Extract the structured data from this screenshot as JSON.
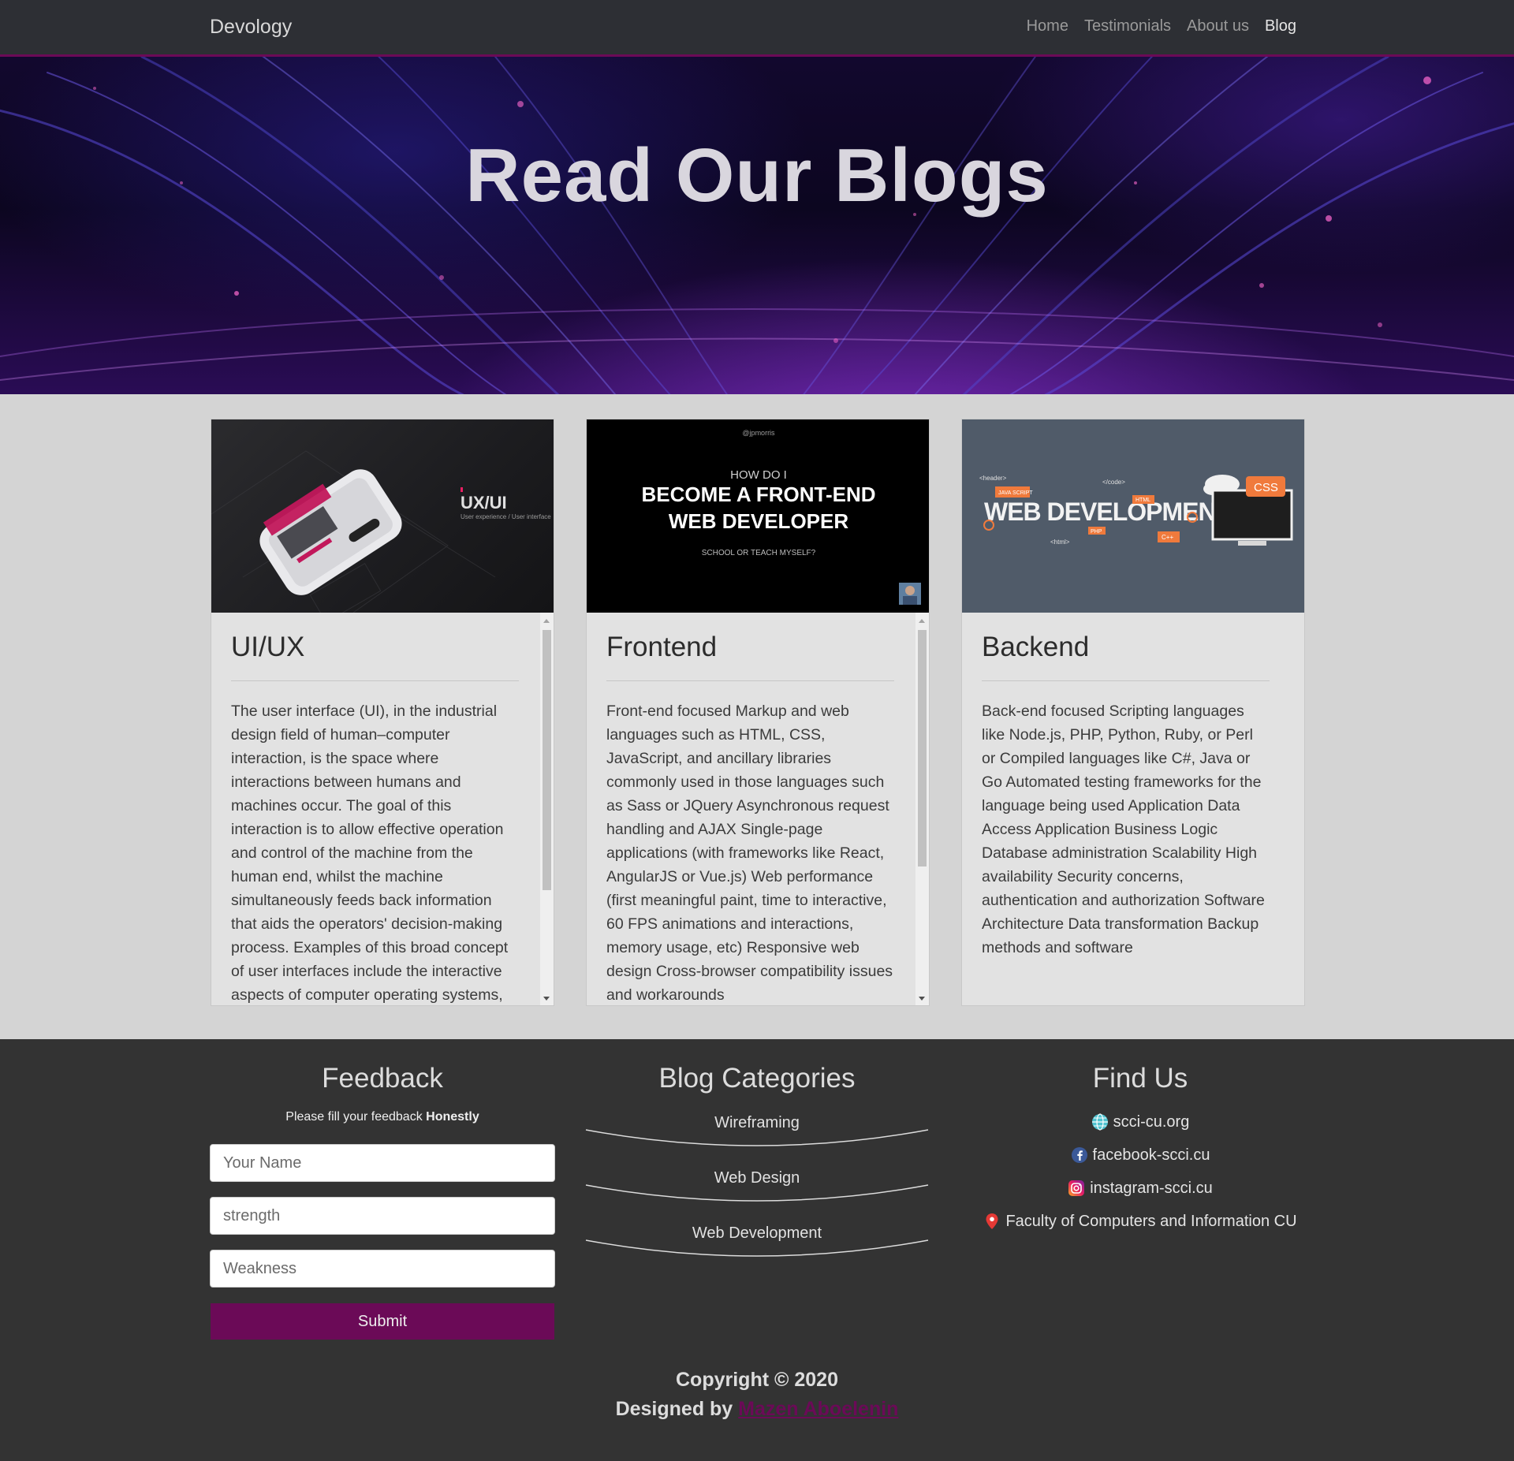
{
  "navbar": {
    "brand": "Devology",
    "links": [
      {
        "label": "Home",
        "active": false
      },
      {
        "label": "Testimonials",
        "active": false
      },
      {
        "label": "About us",
        "active": false
      },
      {
        "label": "Blog",
        "active": true
      }
    ]
  },
  "hero": {
    "title": "Read Our Blogs"
  },
  "cards": [
    {
      "title": "UI/UX",
      "image": {
        "badge": "UX/UI",
        "caption": "User experience / User interface"
      },
      "scroll_fraction": 0.6,
      "text": "The user interface (UI), in the industrial design field of human–computer interaction, is the space where interactions between humans and machines occur. The goal of this interaction is to allow effective operation and control of the machine from the human end, whilst the machine simultaneously feeds back information that aids the operators' decision-making process. Examples of this broad concept of user interfaces include the interactive aspects of computer operating systems,"
    },
    {
      "title": "Frontend",
      "image": {
        "handle": "@jpmorris",
        "line1": "HOW DO I",
        "line2": "BECOME A FRONT-END",
        "line3": "WEB DEVELOPER",
        "line4": "SCHOOL OR TEACH MYSELF?"
      },
      "scroll_fraction": 0.55,
      "text": "Front-end focused Markup and web languages such as HTML, CSS, JavaScript, and ancillary libraries commonly used in those languages such as Sass or JQuery Asynchronous request handling and AJAX Single-page applications (with frameworks like React, AngularJS or Vue.js) Web performance (first meaningful paint, time to interactive, 60 FPS animations and interactions, memory usage, etc) Responsive web design Cross-browser compatibility issues and workarounds"
    },
    {
      "title": "Backend",
      "image": {
        "headline": "WEB DEVELOPMENT",
        "tags": [
          "<header>",
          "JAVA SCRIPT",
          "</code>",
          "HTML",
          "PHP",
          "<html>",
          "C++",
          "CSS"
        ]
      },
      "text": "Back-end focused Scripting languages like Node.js, PHP, Python, Ruby, or Perl or Compiled languages like C#, Java or Go Automated testing frameworks for the language being used Application Data Access Application Business Logic Database administration Scalability High availability Security concerns, authentication and authorization Software Architecture Data transformation Backup methods and software"
    }
  ],
  "footer": {
    "feedback": {
      "title": "Feedback",
      "note_prefix": "Please fill your feedback ",
      "note_bold": "Honestly",
      "name_placeholder": "Your Name",
      "strength_placeholder": "strength",
      "weakness_placeholder": "Weakness",
      "submit_label": "Submit"
    },
    "categories": {
      "title": "Blog Categories",
      "items": [
        "Wireframing",
        "Web Design",
        "Web Development"
      ]
    },
    "find_us": {
      "title": "Find Us",
      "items": [
        {
          "icon": "globe-icon",
          "label": "scci-cu.org"
        },
        {
          "icon": "facebook-icon",
          "label": "facebook-scci.cu"
        },
        {
          "icon": "instagram-icon",
          "label": "instagram-scci.cu"
        },
        {
          "icon": "location-pin-icon",
          "label": "Faculty of Computers and Information CU"
        }
      ]
    },
    "copyright": "Copyright © 2020",
    "designed_by": "Designed by",
    "designer": "Mazen Aboelenin"
  },
  "colors": {
    "accent": "#6b0a57",
    "navbar_bg": "#2d2f34",
    "footer_bg": "#333333",
    "page_bg": "#d4d4d4"
  }
}
